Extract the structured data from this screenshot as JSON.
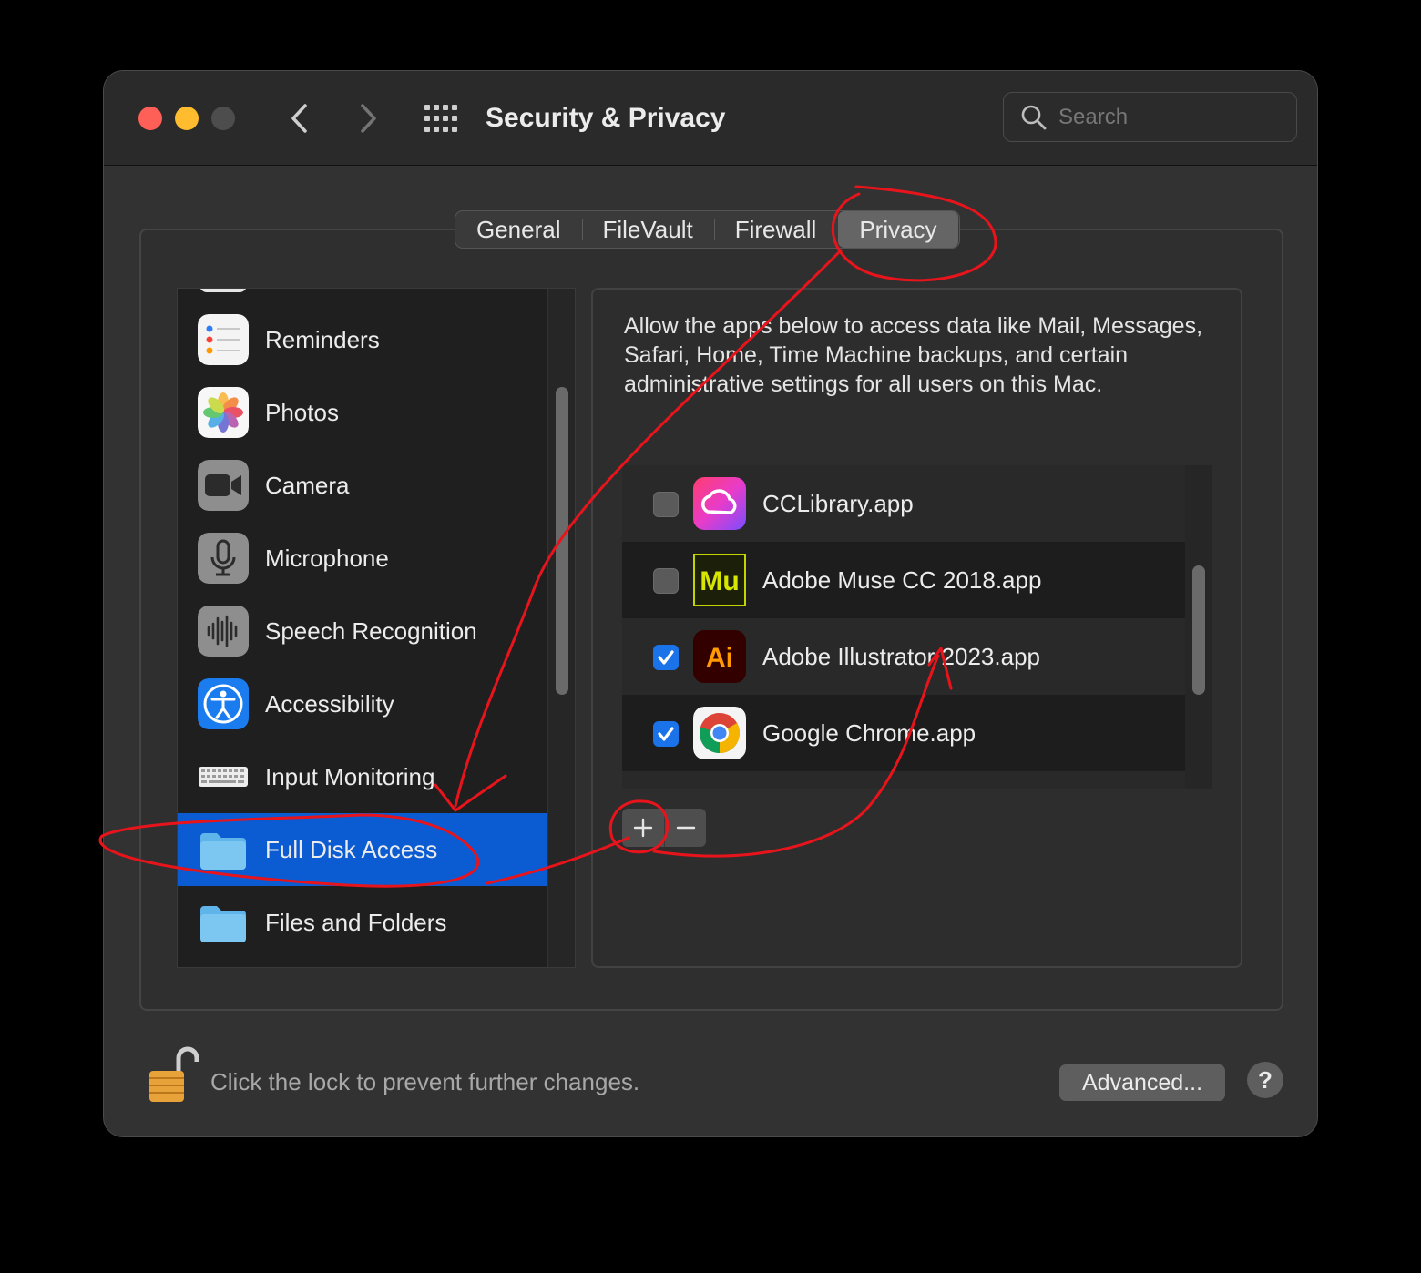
{
  "window": {
    "title": "Security & Privacy",
    "search_placeholder": "Search"
  },
  "tabs": [
    {
      "label": "General",
      "active": false
    },
    {
      "label": "FileVault",
      "active": false
    },
    {
      "label": "Firewall",
      "active": false
    },
    {
      "label": "Privacy",
      "active": true
    }
  ],
  "sidebar": {
    "items": [
      {
        "label": "Reminders",
        "icon": "reminders-icon",
        "selected": false
      },
      {
        "label": "Photos",
        "icon": "photos-icon",
        "selected": false
      },
      {
        "label": "Camera",
        "icon": "camera-icon",
        "selected": false
      },
      {
        "label": "Microphone",
        "icon": "microphone-icon",
        "selected": false
      },
      {
        "label": "Speech Recognition",
        "icon": "speech-recognition-icon",
        "selected": false
      },
      {
        "label": "Accessibility",
        "icon": "accessibility-icon",
        "selected": false
      },
      {
        "label": "Input Monitoring",
        "icon": "keyboard-icon",
        "selected": false
      },
      {
        "label": "Full Disk Access",
        "icon": "folder-icon",
        "selected": true
      },
      {
        "label": "Files and Folders",
        "icon": "folder-icon",
        "selected": false
      }
    ]
  },
  "content": {
    "description": "Allow the apps below to access data like Mail, Messages, Safari, Home, Time Machine backups, and certain administrative settings for all users on this Mac.",
    "apps": [
      {
        "name": "CCLibrary.app",
        "checked": false,
        "icon": "creative-cloud-icon"
      },
      {
        "name": "Adobe Muse CC 2018.app",
        "checked": false,
        "icon": "adobe-muse-icon",
        "icon_text": "Mu"
      },
      {
        "name": "Adobe Illustrator 2023.app",
        "checked": true,
        "icon": "adobe-illustrator-icon",
        "icon_text": "Ai"
      },
      {
        "name": "Google Chrome.app",
        "checked": true,
        "icon": "chrome-icon"
      }
    ]
  },
  "footer": {
    "lock_text": "Click the lock to prevent further changes.",
    "advanced_label": "Advanced...",
    "help_label": "?"
  },
  "colors": {
    "selection": "#0b5bd3",
    "checkbox_on": "#1a73e8",
    "annotation": "#e8141c"
  }
}
